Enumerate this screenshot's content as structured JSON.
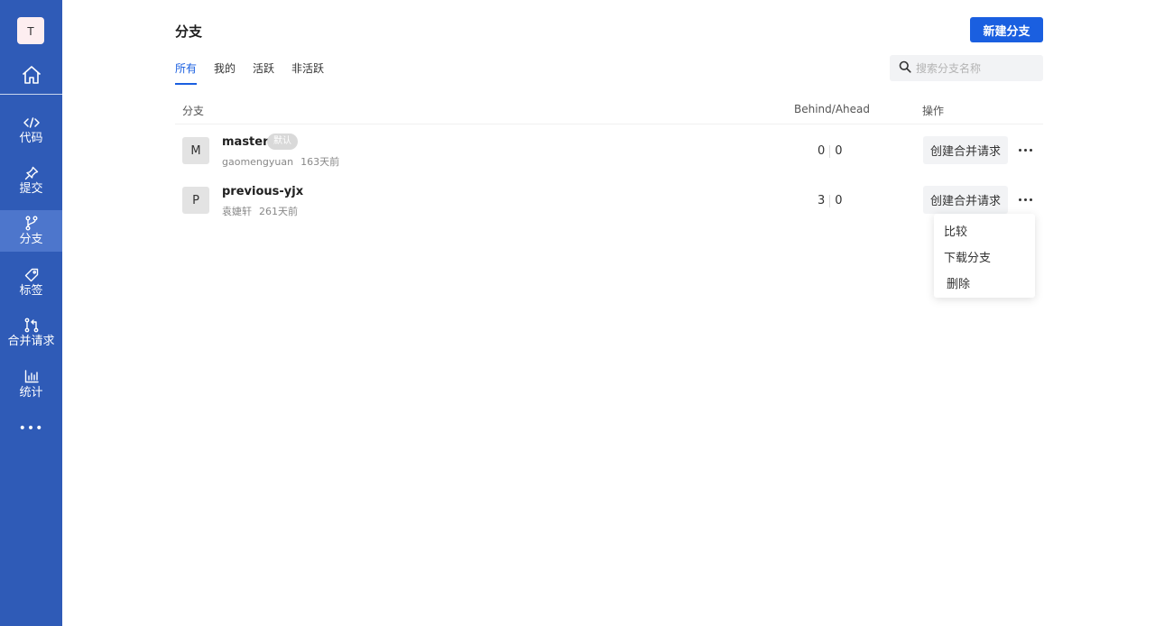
{
  "sidebar": {
    "avatar_letter": "T",
    "items": [
      {
        "label": "代码",
        "icon": "code-icon"
      },
      {
        "label": "提交",
        "icon": "pin-icon"
      },
      {
        "label": "分支",
        "icon": "branch-icon"
      },
      {
        "label": "标签",
        "icon": "tag-icon"
      },
      {
        "label": "合并请求",
        "icon": "merge-request-icon"
      },
      {
        "label": "统计",
        "icon": "chart-icon"
      }
    ],
    "more": "•••",
    "active_color": "#4d76cc",
    "bg_color": "#2f5bb7"
  },
  "header": {
    "title": "分支",
    "new_button": "新建分支"
  },
  "tabs": [
    {
      "label": "所有"
    },
    {
      "label": "我的"
    },
    {
      "label": "活跃"
    },
    {
      "label": "非活跃"
    }
  ],
  "search": {
    "placeholder": "搜索分支名称"
  },
  "table": {
    "headers": {
      "branch": "分支",
      "behind_ahead": "Behind/Ahead",
      "actions": "操作"
    },
    "rows": [
      {
        "avatar": "M",
        "name": "master",
        "badge": "默认",
        "author": "gaomengyuan",
        "time": "163天前",
        "behind": "0",
        "ahead": "0",
        "action": "创建合并请求"
      },
      {
        "avatar": "P",
        "name": "previous-yjx",
        "author": "袁婕轩",
        "time": "261天前",
        "behind": "3",
        "ahead": "0",
        "action": "创建合并请求"
      }
    ]
  },
  "dropdown": {
    "items": [
      "比较",
      "下载分支",
      "删除"
    ]
  },
  "colors": {
    "accent": "#1a5fe0"
  }
}
